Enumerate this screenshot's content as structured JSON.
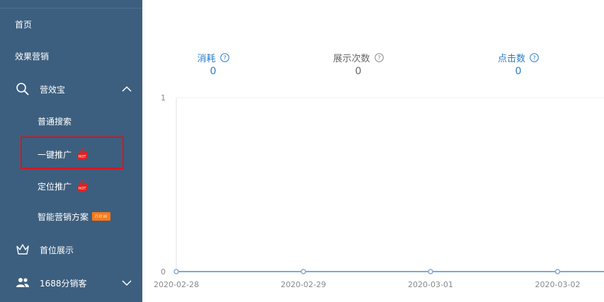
{
  "sidebar": {
    "items": [
      {
        "label": "首页"
      },
      {
        "label": "效果营销"
      },
      {
        "label": "营效宝"
      },
      {
        "label": "普通搜索"
      },
      {
        "label": "一键推广",
        "badge": "HOT"
      },
      {
        "label": "定位推广",
        "badge": "HOT"
      },
      {
        "label": "智能营销方案",
        "badge": "new"
      },
      {
        "label": "首位展示"
      },
      {
        "label": "1688分销客"
      }
    ]
  },
  "metrics": [
    {
      "label": "消耗",
      "value": "0",
      "color": "#2a7cc7"
    },
    {
      "label": "展示次数",
      "value": "0",
      "color": "#666666"
    },
    {
      "label": "点击数",
      "value": "0",
      "color": "#2a7cc7"
    }
  ],
  "colors": {
    "sidebar_bg": "#3d5f7f",
    "accent": "#2a7cc7",
    "highlight": "#e0121a",
    "line": "#7fa9d6"
  },
  "chart_data": {
    "type": "line",
    "x": [
      "2020-02-28",
      "2020-02-29",
      "2020-03-01",
      "2020-03-02"
    ],
    "series": [
      {
        "values": [
          0,
          0,
          0,
          0
        ]
      }
    ],
    "y_ticks": [
      "0",
      "1"
    ],
    "ylim": [
      0,
      1
    ],
    "grid": false
  }
}
